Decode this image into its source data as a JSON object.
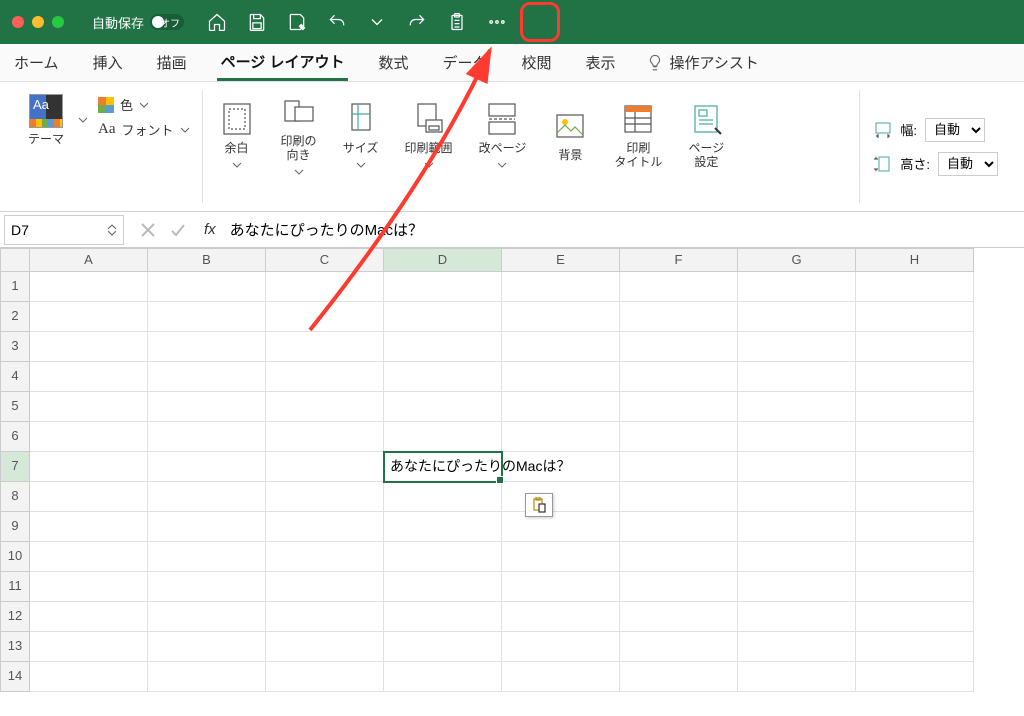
{
  "titlebar": {
    "autosave_label": "自動保存",
    "autosave_state": "オフ"
  },
  "ribbon_tabs": {
    "home": "ホーム",
    "insert": "挿入",
    "draw": "描画",
    "page_layout": "ページ レイアウト",
    "formulas": "数式",
    "data": "データ",
    "review": "校閲",
    "view": "表示",
    "tell_me": "操作アシスト"
  },
  "ribbon": {
    "theme": "テーマ",
    "colors": "色",
    "fonts": "フォント",
    "margins": "余白",
    "orientation": "印刷の\n向き",
    "size": "サイズ",
    "print_area": "印刷範囲",
    "breaks": "改ページ",
    "background": "背景",
    "print_titles": "印刷\nタイトル",
    "page_setup": "ページ\n設定",
    "width": "幅:",
    "height": "高さ:",
    "auto": "自動"
  },
  "formula_bar": {
    "name_box": "D7",
    "formula": "あなたにぴったりのMacは？"
  },
  "grid": {
    "columns": [
      "A",
      "B",
      "C",
      "D",
      "E",
      "F",
      "G",
      "H"
    ],
    "active_col": "D",
    "active_row": 7,
    "cell_text": "あなたにぴったりのMacは？"
  }
}
